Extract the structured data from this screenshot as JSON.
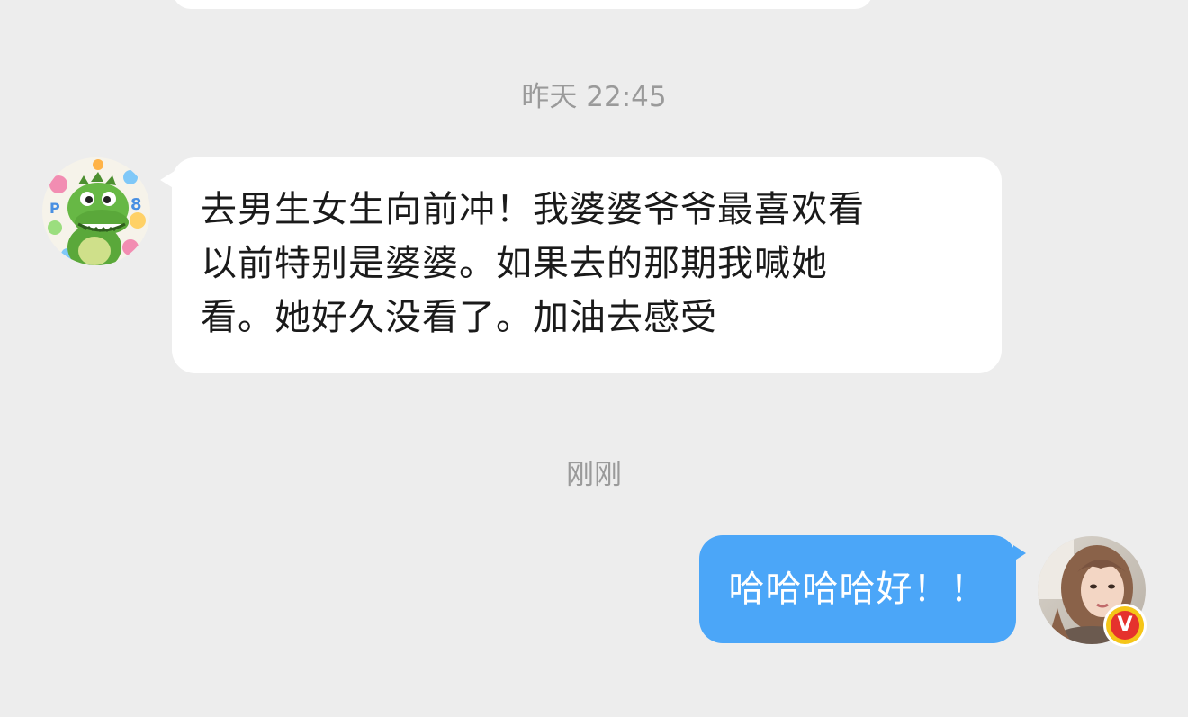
{
  "chat": {
    "timestamps": {
      "yesterday": "昨天 22:45",
      "now": "刚刚"
    },
    "messages": [
      {
        "sender": "other",
        "avatar": "dinosaur-avatar",
        "lines": [
          "去男生女生向前冲！我婆婆爷爷最喜欢看",
          "以前特别是婆婆。如果去的那期我喊她",
          "看。她好久没看了。加油去感受"
        ]
      },
      {
        "sender": "me",
        "avatar": "user-photo-avatar",
        "text": "哈哈哈哈好！！",
        "badge": "V"
      }
    ]
  },
  "colors": {
    "background": "#ededed",
    "incoming_bubble": "#ffffff",
    "outgoing_bubble": "#4ba6f8",
    "timestamp": "#9a9a9a",
    "vip_badge_outer": "#f5c518",
    "vip_badge_inner": "#e5322d"
  }
}
